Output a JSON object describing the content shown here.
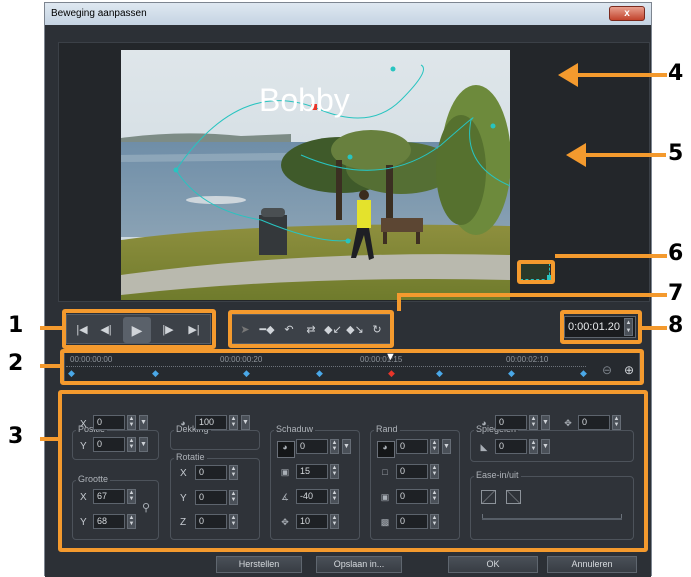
{
  "window": {
    "title": "Beweging aanpassen",
    "close_label": "x"
  },
  "preview": {
    "overlay_text": "Bobby"
  },
  "callouts": [
    "1",
    "2",
    "3",
    "4",
    "5",
    "6",
    "7",
    "8"
  ],
  "playback": {
    "buttons": [
      "go-to-start",
      "previous-frame",
      "play",
      "next-frame",
      "go-to-end"
    ]
  },
  "path_tools": {
    "buttons": [
      "select-node",
      "add-node",
      "delete-node",
      "reverse-path",
      "align-left",
      "align-right",
      "reset-path"
    ]
  },
  "timecode": {
    "value": "0:00:01.20"
  },
  "timeline": {
    "ticks": [
      "00:00:00:00",
      "00:00:00:20",
      "00:00:01:15",
      "00:00:02:10"
    ]
  },
  "position": {
    "title": "Positie",
    "x_label": "X",
    "x_value": "0",
    "y_label": "Y",
    "y_value": "0"
  },
  "size": {
    "title": "Grootte",
    "x_label": "X",
    "x_value": "67",
    "y_label": "Y",
    "y_value": "68"
  },
  "opacity": {
    "title": "Dekking",
    "value": "100"
  },
  "rotation": {
    "title": "Rotatie",
    "x_label": "X",
    "x_value": "0",
    "y_label": "Y",
    "y_value": "0",
    "z_label": "Z",
    "z_value": "0"
  },
  "shadow": {
    "title": "Schaduw",
    "opacity": "0",
    "blur": "15",
    "angle": "-40",
    "distance": "10"
  },
  "border": {
    "title": "Rand",
    "opacity": "0",
    "width": "0",
    "softness": "0",
    "inner": "0"
  },
  "mirror": {
    "title": "Spiegelen",
    "opacity": "0",
    "distance": "0",
    "fade": "0"
  },
  "ease": {
    "title": "Ease-in/uit"
  },
  "footer": {
    "reset": "Herstellen",
    "save": "Opslaan in...",
    "ok": "OK",
    "cancel": "Annuleren"
  },
  "colors": {
    "accent": "#f49a2e",
    "path": "#28c4c0",
    "node_active": "#e8352a"
  }
}
